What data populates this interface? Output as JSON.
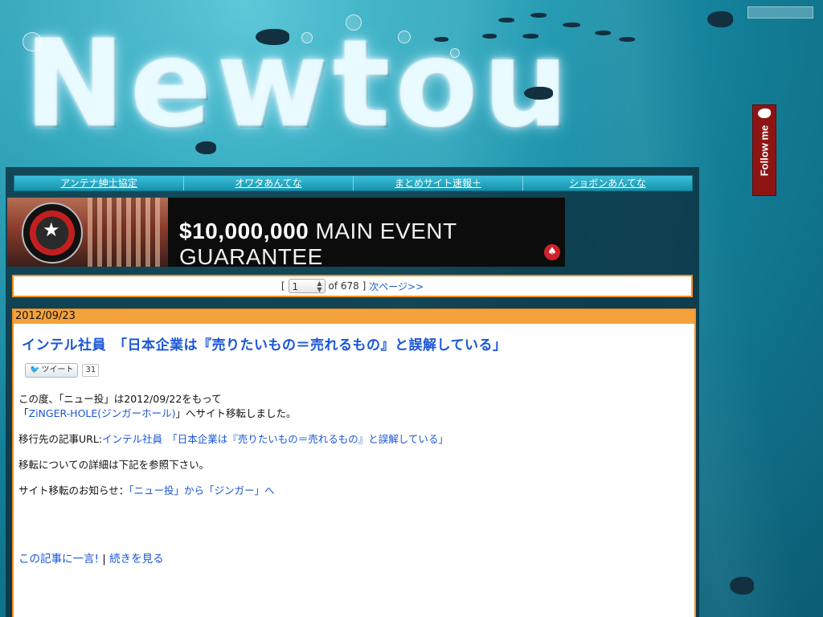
{
  "header": {
    "logo_text": "Newtou"
  },
  "colors": {
    "accent": "#f4901e",
    "link": "#1a56d6",
    "nav": "#1ea6c2",
    "follow": "#8e1414"
  },
  "follow_widget": {
    "label": "Follow me"
  },
  "nav": {
    "items": [
      {
        "label": "アンテナ紳士協定"
      },
      {
        "label": "オワタあんてな"
      },
      {
        "label": "まとめサイト速報＋"
      },
      {
        "label": "ショボンあんてな"
      }
    ]
  },
  "banner": {
    "amount": "$10,000,000",
    "headline": "MAIN EVENT GUARANTEE"
  },
  "pager": {
    "open_bracket": "[",
    "current_page": "1",
    "of_text": "of 678 ]",
    "next_label": "次ページ>>"
  },
  "post": {
    "date": "2012/09/23",
    "title": "インテル社員　「日本企業は『売りたいもの＝売れるもの』と誤解している」",
    "tweet_label": "ツイート",
    "tweet_count": "31",
    "line1": "この度、「ニュー投」は2012/09/22をもって",
    "line2_open": "「",
    "line2_link": "ZiNGER-HOLE(ジンガーホール)",
    "line2_rest": "」へサイト移転しました。",
    "url_prefix": "移行先の記事URL:",
    "url_link": "インテル社員　「日本企業は『売りたいもの＝売れるもの』と誤解している」",
    "details": "移転についての詳細は下記を参照下さい。",
    "notice_prefix": "サイト移転のお知らせ：",
    "notice_link": "「ニュー投」から「ジンガー」へ",
    "comment_link": "この記事に一言!",
    "separator": "|",
    "more_link": "続きを見る"
  }
}
